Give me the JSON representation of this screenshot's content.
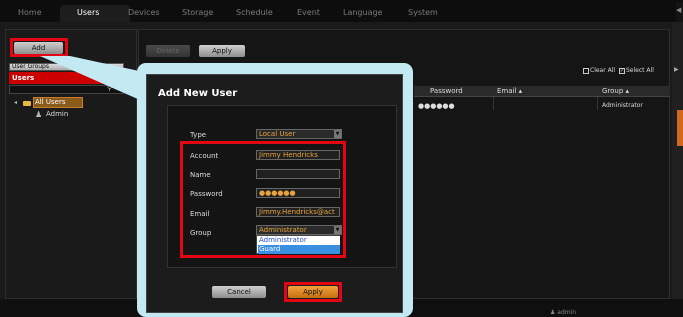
{
  "nav": {
    "tabs": [
      "Home",
      "Users",
      "Devices",
      "Storage",
      "Schedule",
      "Event",
      "Language",
      "System"
    ],
    "active": "Users"
  },
  "left_panel": {
    "add_button": "Add",
    "user_groups_label": "User Groups",
    "users_label": "Users",
    "tree": {
      "root": "All Users",
      "children": [
        "Admin"
      ]
    }
  },
  "toolbar": {
    "delete_button": "Delete",
    "apply_button": "Apply"
  },
  "table": {
    "clear_all": "Clear All",
    "select_all": "Select All",
    "columns": [
      "Password",
      "Email ▴",
      "Group ▴"
    ],
    "rows": [
      {
        "password": "●●●●●●",
        "email": "",
        "group": "Administrator"
      }
    ]
  },
  "dialog": {
    "title": "Add New User",
    "fields": {
      "type": {
        "label": "Type",
        "value": "Local User"
      },
      "account": {
        "label": "Account",
        "value": "Jimmy Hendricks"
      },
      "name": {
        "label": "Name",
        "value": ""
      },
      "password": {
        "label": "Password",
        "value": "●●●●●●"
      },
      "email": {
        "label": "Email",
        "value": "Jimmy.Hendricks@act"
      },
      "group": {
        "label": "Group",
        "value": "Administrator",
        "options": [
          "Administrator",
          "Guard"
        ],
        "highlighted": "Guard"
      }
    },
    "cancel_button": "Cancel",
    "apply_button": "Apply"
  },
  "status_bar": {
    "text": "admin"
  },
  "colors": {
    "highlight": "#e30613",
    "dialog_frame": "#c3e9f2",
    "field_text": "#e8a33c",
    "tree_selected": "#8a5a1a"
  }
}
